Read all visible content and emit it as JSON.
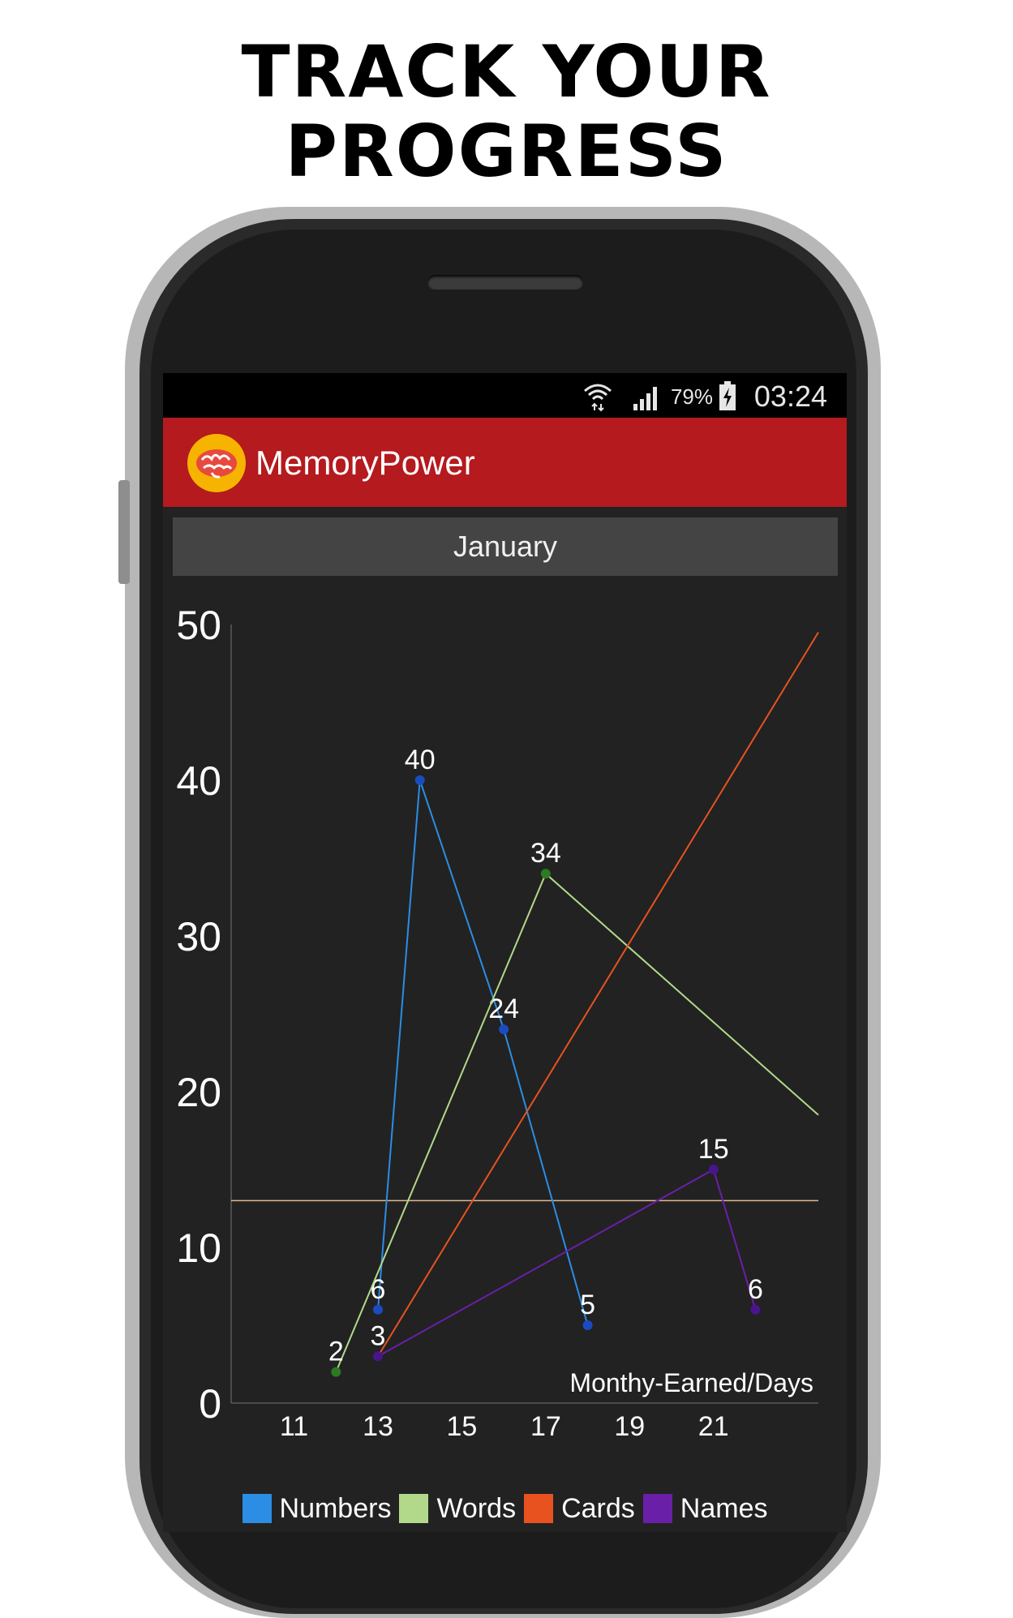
{
  "headline": {
    "line1": "TRACK YOUR",
    "line2": "PROGRESS"
  },
  "status_bar": {
    "battery_percent": "79%",
    "time": "03:24"
  },
  "app_bar": {
    "title": "MemoryPower"
  },
  "month_selector": {
    "label": "January"
  },
  "colors": {
    "app_bar": "#b41a1e",
    "numbers": "#2b8de4",
    "words": "#b2d98a",
    "cards": "#e8521f",
    "names": "#6a1fa8",
    "reference_line": "#e3b98c"
  },
  "chart_data": {
    "type": "line",
    "xlabel": "Monthy-Earned/Days",
    "ylabel": "",
    "xlim": [
      9.5,
      23.5
    ],
    "ylim": [
      0,
      50
    ],
    "x_ticks": [
      "11",
      "13",
      "15",
      "17",
      "19",
      "21"
    ],
    "x_tick_values": [
      11,
      13,
      15,
      17,
      19,
      21
    ],
    "y_ticks": [
      "0",
      "10",
      "20",
      "30",
      "40",
      "50"
    ],
    "y_tick_values": [
      0,
      10,
      20,
      30,
      40,
      50
    ],
    "reference_line_y": 13.0,
    "series": [
      {
        "name": "Numbers",
        "color": "#2b8de4",
        "marker": "#1a4cc0",
        "points": [
          {
            "x": 13,
            "y": 6,
            "label": "6"
          },
          {
            "x": 14,
            "y": 40,
            "label": "40"
          },
          {
            "x": 16,
            "y": 24,
            "label": "24"
          },
          {
            "x": 18,
            "y": 5,
            "label": "5"
          }
        ]
      },
      {
        "name": "Words",
        "color": "#b2d98a",
        "marker": "#2c7a21",
        "points": [
          {
            "x": 12,
            "y": 2,
            "label": "2"
          },
          {
            "x": 17,
            "y": 34,
            "label": "34"
          },
          {
            "x": 23.5,
            "y": 18.5,
            "label": ""
          }
        ]
      },
      {
        "name": "Cards",
        "color": "#e8521f",
        "marker": "#b33a12",
        "points": [
          {
            "x": 13,
            "y": 3,
            "label": ""
          },
          {
            "x": 23.5,
            "y": 49.5,
            "label": ""
          }
        ]
      },
      {
        "name": "Names",
        "color": "#6a1fa8",
        "marker": "#4a148c",
        "points": [
          {
            "x": 13,
            "y": 3,
            "label": "3"
          },
          {
            "x": 21,
            "y": 15,
            "label": "15"
          },
          {
            "x": 22,
            "y": 6,
            "label": "6"
          }
        ]
      }
    ]
  },
  "legend": [
    {
      "label": "Numbers",
      "color": "#2b8de4"
    },
    {
      "label": "Words",
      "color": "#b2d98a"
    },
    {
      "label": "Cards",
      "color": "#e8521f"
    },
    {
      "label": "Names",
      "color": "#6a1fa8"
    }
  ]
}
